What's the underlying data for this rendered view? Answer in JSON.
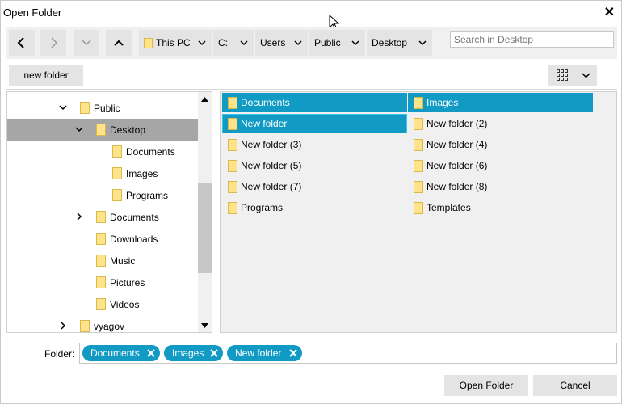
{
  "window": {
    "title": "Open Folder"
  },
  "nav": {
    "breadcrumbs": [
      {
        "label": "This PC",
        "folder": true
      },
      {
        "label": "C:",
        "folder": false
      },
      {
        "label": "Users",
        "folder": false
      },
      {
        "label": "Public",
        "folder": false
      },
      {
        "label": "Desktop",
        "folder": false
      }
    ],
    "search_placeholder": "Search in Desktop"
  },
  "toolbar": {
    "new_folder_label": "new folder"
  },
  "tree": {
    "items": [
      {
        "label": "Public",
        "expanded": true,
        "hasArrow": true,
        "selected": false,
        "level": 1
      },
      {
        "label": "Desktop",
        "expanded": true,
        "hasArrow": true,
        "selected": true,
        "level": 2
      },
      {
        "label": "Documents",
        "hasArrow": false,
        "level": 3
      },
      {
        "label": "Images",
        "hasArrow": false,
        "level": 3
      },
      {
        "label": "Programs",
        "hasArrow": false,
        "level": 3
      },
      {
        "label": "Documents",
        "expanded": false,
        "hasArrow": true,
        "level": 2
      },
      {
        "label": "Downloads",
        "hasArrow": false,
        "level": 2
      },
      {
        "label": "Music",
        "hasArrow": false,
        "level": 2
      },
      {
        "label": "Pictures",
        "hasArrow": false,
        "level": 2
      },
      {
        "label": "Videos",
        "hasArrow": false,
        "level": 2
      },
      {
        "label": "vyagov",
        "expanded": false,
        "hasArrow": true,
        "level": 1
      }
    ]
  },
  "files": [
    {
      "label": "Documents",
      "state": "selected"
    },
    {
      "label": "Images",
      "state": "selected"
    },
    {
      "label": "New folder",
      "state": "focused"
    },
    {
      "label": "New folder (2)",
      "state": ""
    },
    {
      "label": "New folder (3)",
      "state": ""
    },
    {
      "label": "New folder (4)",
      "state": ""
    },
    {
      "label": "New folder (5)",
      "state": ""
    },
    {
      "label": "New folder (6)",
      "state": ""
    },
    {
      "label": "New folder (7)",
      "state": ""
    },
    {
      "label": "New folder (8)",
      "state": ""
    },
    {
      "label": "Programs",
      "state": ""
    },
    {
      "label": "Templates",
      "state": ""
    }
  ],
  "folder_field": {
    "label": "Folder:",
    "chips": [
      "Documents",
      "Images",
      "New folder"
    ]
  },
  "buttons": {
    "open_label": "Open Folder",
    "cancel_label": "Cancel"
  },
  "colors": {
    "accent": "#119ac3",
    "tree_selected": "#a6a6a6",
    "folder": "#ffe38a"
  }
}
